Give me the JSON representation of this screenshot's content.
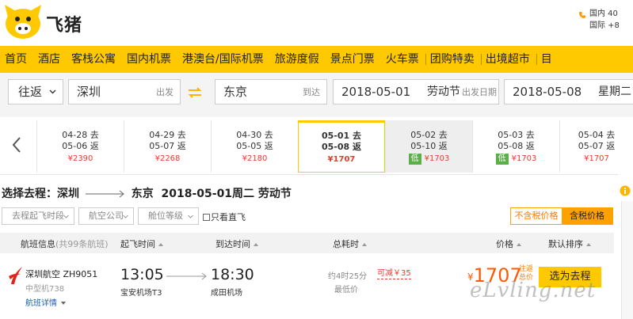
{
  "brand": {
    "logo_text": "飞猪",
    "accent": "#ffc900",
    "price_color": "#ff5a00"
  },
  "contact": {
    "line1": "国内 40",
    "line2": "国际 +8"
  },
  "nav": [
    "首页",
    "酒店",
    "客栈公寓",
    "国内机票",
    "港澳台/国际机票",
    "旅游度假",
    "景点门票",
    "火车票",
    "团购特卖",
    "出境超市",
    "目"
  ],
  "search": {
    "trip_type": "往返",
    "from_city": "深圳",
    "from_hint": "出发",
    "to_city": "东京",
    "to_hint": "到达",
    "depart_date": "2018-05-01",
    "depart_holiday": "劳动节",
    "depart_hint": "出发日期",
    "return_date": "2018-05-08",
    "return_weekday": "星期二"
  },
  "date_strip": [
    {
      "go": "04-28 去",
      "back": "05-06 返",
      "price": "¥2390",
      "low": ""
    },
    {
      "go": "04-29 去",
      "back": "05-07 返",
      "price": "¥2268",
      "low": ""
    },
    {
      "go": "04-30 去",
      "back": "05-05 返",
      "price": "¥2180",
      "low": ""
    },
    {
      "go": "05-01 去",
      "back": "05-08 返",
      "price": "¥1707",
      "low": ""
    },
    {
      "go": "05-02 去",
      "back": "05-10 返",
      "price": "¥1703",
      "low": "低"
    },
    {
      "go": "05-03 去",
      "back": "05-08 返",
      "price": "¥1703",
      "low": "低"
    },
    {
      "go": "05-04 去",
      "back": "05-07 返",
      "price": "¥1707",
      "low": ""
    }
  ],
  "route": {
    "label": "选择去程：",
    "from": "深圳",
    "to": "东京",
    "date": "2018-05-01周二 劳动节"
  },
  "filters": {
    "time": "去程起飞时段",
    "airline": "航空公司",
    "cabin": "舱位等级",
    "direct": "只看直飞",
    "tax_excl": "不含税价格",
    "tax_incl": "含税价格"
  },
  "table_head": {
    "flight": "航班信息",
    "flight_sub": "(共99条航班)",
    "dep": "起飞时间",
    "arr": "到达时间",
    "dur": "总耗时",
    "price": "价格",
    "sort": "默认排序"
  },
  "flight": {
    "airline": "深圳航空 ZH9051",
    "model": "中型机738",
    "detail": "航班详情",
    "dep_time": "13:05",
    "dep_airport": "宝安机场T3",
    "arr_time": "18:30",
    "arr_airport": "成田机场",
    "duration": "约4时25分",
    "low_label": "最低价",
    "discount": "可减￥35",
    "price_symbol": "¥",
    "price": "1707",
    "price_tag": "往返总价",
    "select_label": "选为去程"
  },
  "watermark": "eLvling.net"
}
